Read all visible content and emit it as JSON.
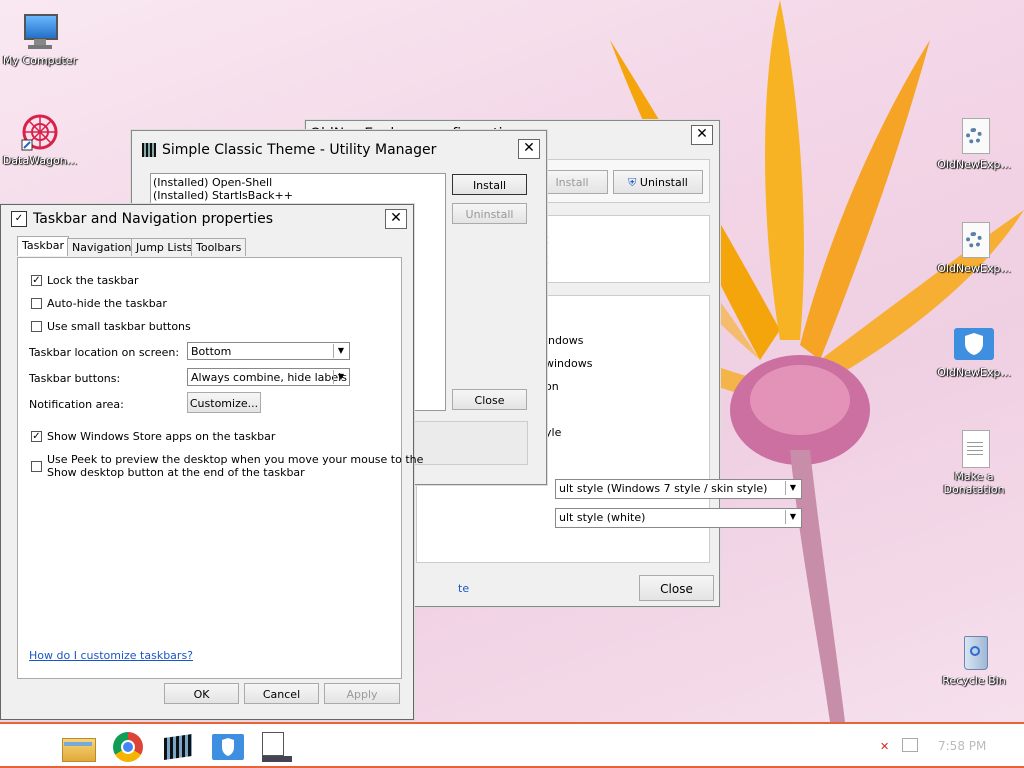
{
  "desktop": {
    "icons_left": [
      {
        "label": "My Computer",
        "icon": "computer-icon"
      },
      {
        "label": "DataWagon...",
        "icon": "datawagon-icon"
      }
    ],
    "icons_right": [
      {
        "label": "OldNewExp...",
        "icon": "settings-file-icon"
      },
      {
        "label": "OldNewExp...",
        "icon": "settings-file-icon"
      },
      {
        "label": "OldNewExp...",
        "icon": "shield-icon"
      },
      {
        "label": "Make a",
        "label2": "Donatation",
        "icon": "document-icon"
      },
      {
        "label": "Recycle Bin",
        "icon": "recycle-bin-icon"
      }
    ]
  },
  "oldnew_window": {
    "title": "OldNewExplorer configuration",
    "install_label": "Install",
    "uninstall_label": "Uninstall",
    "fragments": [
      "C",
      "C"
    ],
    "options": [
      "indows",
      "windows",
      "on",
      "yle"
    ],
    "combo1": "ult style (Windows 7 style / skin style)",
    "combo2": "ult style (white)",
    "link_fragment": "te",
    "close_label": "Close"
  },
  "utility_window": {
    "title": "Simple Classic Theme - Utility Manager",
    "list_items": [
      "(Installed) Open-Shell",
      "(Installed) StartIsBack++"
    ],
    "install_label": "Install",
    "uninstall_label": "Uninstall",
    "close_label": "Close"
  },
  "taskbar_props": {
    "title": "Taskbar and Navigation properties",
    "tabs": [
      "Taskbar",
      "Navigation",
      "Jump Lists",
      "Toolbars"
    ],
    "lock_taskbar": "Lock the taskbar",
    "auto_hide": "Auto-hide the taskbar",
    "small_buttons": "Use small taskbar buttons",
    "location_label": "Taskbar location on screen:",
    "location_value": "Bottom",
    "buttons_label": "Taskbar buttons:",
    "buttons_value": "Always combine, hide labels",
    "notification_label": "Notification area:",
    "customize_label": "Customize...",
    "store_apps": "Show Windows Store apps on the taskbar",
    "peek_line1": "Use Peek to preview the desktop when you move your mouse to the",
    "peek_line2": "Show desktop button at the end of the taskbar",
    "help_link": "How do I customize taskbars?",
    "ok_label": "OK",
    "cancel_label": "Cancel",
    "apply_label": "Apply"
  },
  "taskbar": {
    "time": "7:58 PM"
  }
}
